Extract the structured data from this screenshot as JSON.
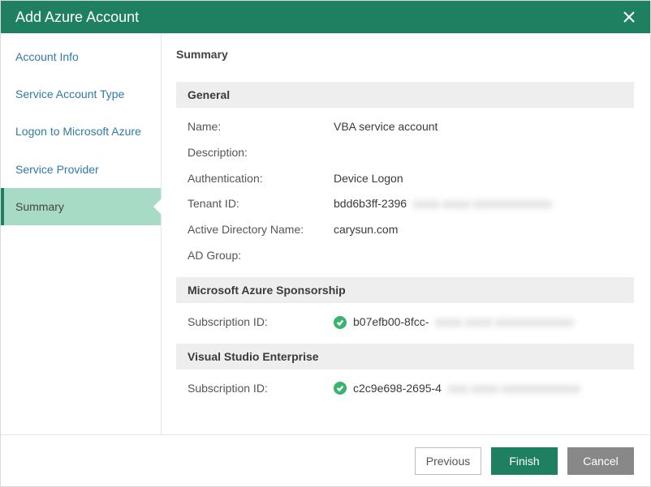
{
  "title": "Add Azure Account",
  "sidebar": {
    "items": [
      {
        "label": "Account Info"
      },
      {
        "label": "Service Account Type"
      },
      {
        "label": "Logon to Microsoft Azure"
      },
      {
        "label": "Service Provider"
      },
      {
        "label": "Summary"
      }
    ]
  },
  "main": {
    "heading": "Summary",
    "sections": {
      "general": {
        "title": "General",
        "rows": {
          "name": {
            "label": "Name:",
            "value": "VBA service account"
          },
          "desc": {
            "label": "Description:",
            "value": ""
          },
          "auth": {
            "label": "Authentication:",
            "value": "Device Logon"
          },
          "tenant": {
            "label": "Tenant ID:",
            "value": "bdd6b3ff-2396",
            "masked": "xxxx-xxxx-xxxxxxxxxxxx"
          },
          "adname": {
            "label": "Active Directory Name:",
            "value": "carysun.com"
          },
          "adgroup": {
            "label": "AD Group:",
            "value": ""
          }
        }
      },
      "sponsorship": {
        "title": "Microsoft Azure Sponsorship",
        "rows": {
          "sub": {
            "label": "Subscription ID:",
            "value": "b07efb00-8fcc-",
            "masked": "xxxx-xxxx-xxxxxxxxxxxx",
            "checked": true
          }
        }
      },
      "vse": {
        "title": "Visual Studio Enterprise",
        "rows": {
          "sub": {
            "label": "Subscription ID:",
            "value": "c2c9e698-2695-4",
            "masked": "xxx-xxxx-xxxxxxxxxxxx",
            "checked": true
          }
        }
      }
    }
  },
  "footer": {
    "previous": "Previous",
    "finish": "Finish",
    "cancel": "Cancel"
  }
}
